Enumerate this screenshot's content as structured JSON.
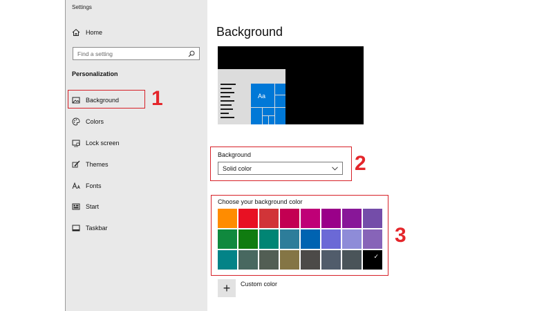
{
  "window": {
    "title": "Settings"
  },
  "sidebar": {
    "home_label": "Home",
    "search_placeholder": "Find a setting",
    "section_title": "Personalization",
    "items": [
      {
        "label": "Background",
        "icon": "image-icon"
      },
      {
        "label": "Colors",
        "icon": "palette-icon"
      },
      {
        "label": "Lock screen",
        "icon": "lock-screen-icon"
      },
      {
        "label": "Themes",
        "icon": "brush-icon"
      },
      {
        "label": "Fonts",
        "icon": "font-icon"
      },
      {
        "label": "Start",
        "icon": "start-grid-icon"
      },
      {
        "label": "Taskbar",
        "icon": "taskbar-icon"
      }
    ]
  },
  "main": {
    "title": "Background",
    "preview": {
      "tile_text": "Aa"
    },
    "background_field": {
      "label": "Background",
      "value": "Solid color"
    },
    "color_picker": {
      "label": "Choose your background color",
      "selected_index": 23,
      "colors": [
        "#ff8c00",
        "#e81123",
        "#d13438",
        "#c30052",
        "#bf0077",
        "#9a0089",
        "#881798",
        "#744da9",
        "#10893e",
        "#107c10",
        "#018574",
        "#2d7d9a",
        "#0063b1",
        "#6b69d6",
        "#8e8cd8",
        "#8764b8",
        "#038387",
        "#486860",
        "#525e54",
        "#847545",
        "#4c4a48",
        "#515c6b",
        "#4a5459",
        "#000000"
      ]
    },
    "custom_color": {
      "label": "Custom color",
      "icon_glyph": "+"
    }
  },
  "annotations": {
    "callout_1": "1",
    "callout_2": "2",
    "callout_3": "3"
  },
  "theme": {
    "accent": "#0078d7",
    "highlight": "#d61f26"
  }
}
